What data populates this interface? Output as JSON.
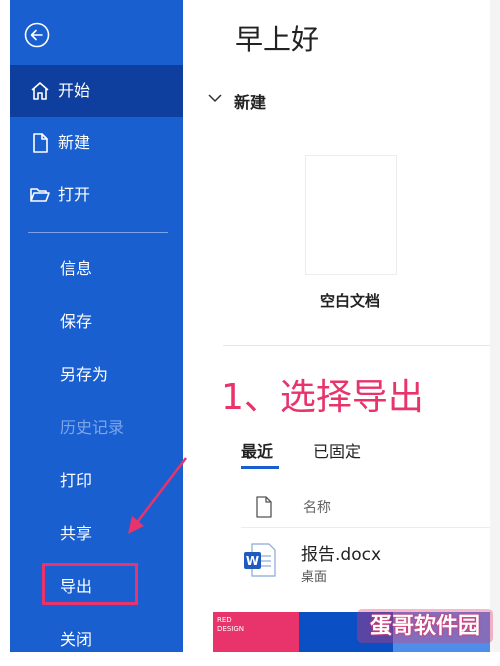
{
  "sidebar": {
    "back_icon": "back-arrow-circle-icon",
    "top_items": [
      {
        "label": "开始",
        "icon": "home-icon"
      },
      {
        "label": "新建",
        "icon": "new-document-icon"
      },
      {
        "label": "打开",
        "icon": "open-folder-icon"
      }
    ],
    "sub_items": [
      {
        "label": "信息"
      },
      {
        "label": "保存"
      },
      {
        "label": "另存为"
      },
      {
        "label": "历史记录"
      },
      {
        "label": "打印"
      },
      {
        "label": "共享"
      },
      {
        "label": "导出"
      },
      {
        "label": "关闭"
      }
    ]
  },
  "main": {
    "greeting": "早上好",
    "new_section": {
      "title": "新建",
      "blank_label": "空白文档"
    },
    "annotation": "1、选择导出",
    "tabs": [
      {
        "label": "最近"
      },
      {
        "label": "已固定"
      }
    ],
    "file_list": {
      "column_name": "名称",
      "files": [
        {
          "name": "报告.docx",
          "location": "桌面",
          "icon": "word-icon"
        }
      ]
    },
    "thumbnail_text": "RED\nDESIGN"
  },
  "watermark": "蛋哥软件园",
  "colors": {
    "sidebar": "#1a5fd0",
    "sidebar_active": "#0e3f9e",
    "annotation": "#e8336b"
  }
}
